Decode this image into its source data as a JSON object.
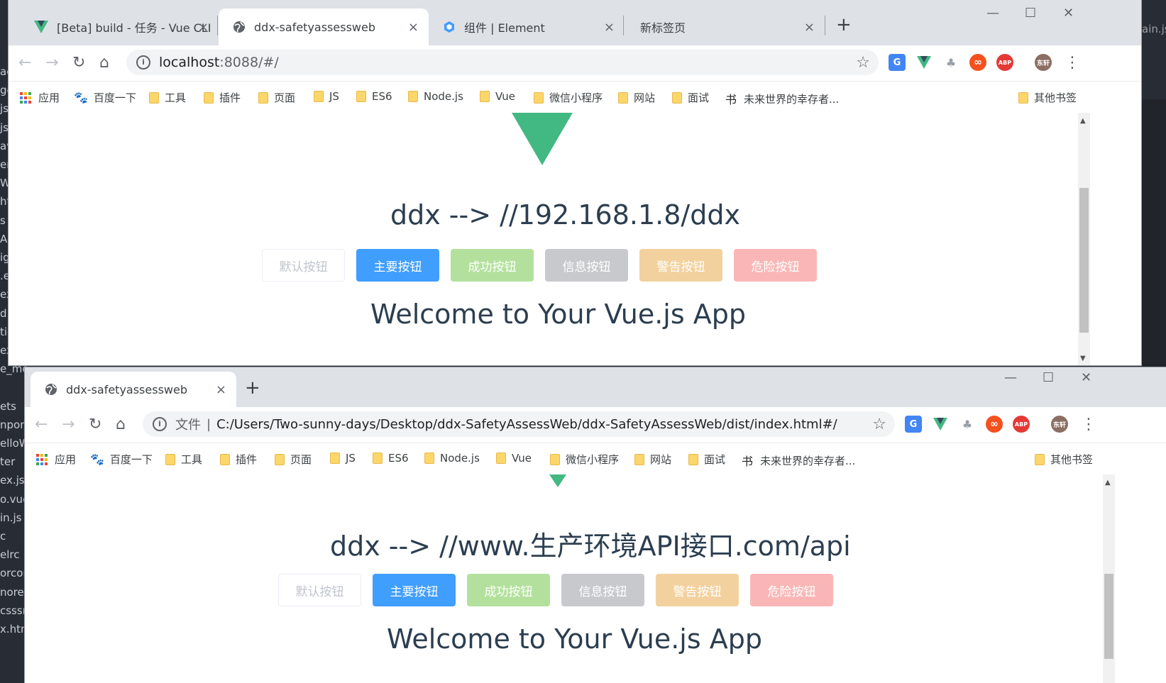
{
  "editor": {
    "lines_left": [
      "ac",
      "ge",
      "js",
      "js",
      "av",
      "en",
      "W",
      "ht",
      "s",
      "AS",
      "ig",
      ".e",
      "ex",
      "d",
      "tic",
      "ex.ht",
      "e_mo",
      "",
      "ets",
      "npon",
      "elloW",
      "ter",
      "ex.js",
      "o.vue",
      "in.js",
      "c",
      "elrc",
      "orcor",
      "nore",
      "csssrc",
      "x.htm"
    ],
    "right_text": "ain.js"
  },
  "window1": {
    "tabs": [
      {
        "title": "[Beta] build - 任务 - Vue CLI",
        "icon": "vue-icon"
      },
      {
        "title": "ddx-safetyassessweb",
        "icon": "globe-icon",
        "active": true
      },
      {
        "title": "组件 | Element",
        "icon": "element-icon"
      },
      {
        "title": "新标签页",
        "icon": ""
      }
    ],
    "url": "localhost",
    "url_suffix": ":8088/#/",
    "hello": "ddx --> //192.168.1.8/ddx",
    "welcome": "Welcome to Your Vue.js App"
  },
  "window2": {
    "tabs": [
      {
        "title": "ddx-safetyassessweb",
        "icon": "globe-icon",
        "active": true
      }
    ],
    "url_label": "文件",
    "url_sep": "|",
    "url": "C:/Users/Two-sunny-days/Desktop/ddx-SafetyAssessWeb/ddx-SafetyAssessWeb/dist/index.html#/",
    "hello": "ddx --> //www.生产环境API接口.com/api",
    "welcome": "Welcome to Your Vue.js App"
  },
  "bookmarks": {
    "apps": "应用",
    "baidu": "百度一下",
    "folders": [
      "工具",
      "插件",
      "页面",
      "JS",
      "ES6",
      "Node.js",
      "Vue",
      "微信小程序",
      "网站",
      "面试"
    ],
    "future": "未来世界的幸存者...",
    "other": "其他书签"
  },
  "buttons": {
    "default": "默认按钮",
    "primary": "主要按钮",
    "success": "成功按钮",
    "info": "信息按钮",
    "warning": "警告按钮",
    "danger": "危险按钮"
  },
  "controls": {
    "close": "×",
    "newtab": "+",
    "minimize": "—",
    "maximize": "☐",
    "winclose": "✕",
    "back": "←",
    "forward": "→",
    "reload": "↻",
    "home": "⌂",
    "star": "☆",
    "menu": "⋮",
    "avatar": "东轩",
    "abp": "ABP"
  },
  "colors": {
    "vue_green": "#42b883",
    "vue_dark": "#35495e",
    "text": "#2c3e50",
    "primary": "#409eff"
  }
}
